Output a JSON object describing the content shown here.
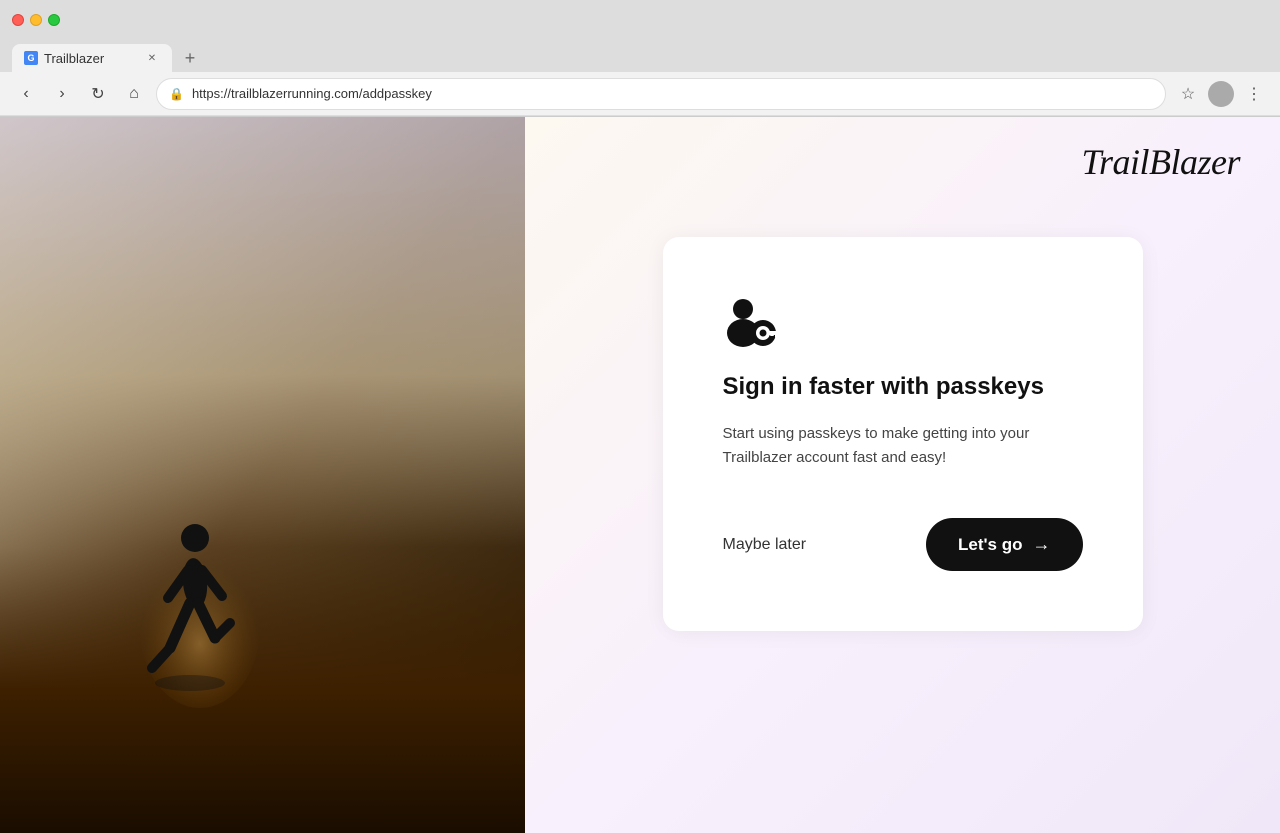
{
  "browser": {
    "tab_title": "Trailblazer",
    "url": "https://trailblazerrunning.com/addpasskey",
    "favicon_letter": "G"
  },
  "nav": {
    "back": "‹",
    "forward": "›",
    "refresh": "↻",
    "home": "⌂",
    "bookmark": "☆",
    "menu": "⋮",
    "new_tab": "+"
  },
  "brand": {
    "logo": "TrailBlazer"
  },
  "card": {
    "title": "Sign in faster with passkeys",
    "description": "Start using passkeys to make getting into your Trailblazer account fast and easy!",
    "maybe_later": "Maybe later",
    "lets_go": "Let's go"
  },
  "colors": {
    "button_bg": "#111111",
    "button_text": "#ffffff",
    "maybe_later_color": "#333333"
  }
}
